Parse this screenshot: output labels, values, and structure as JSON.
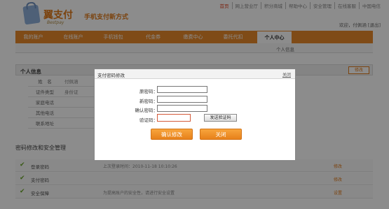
{
  "brand": {
    "logo_text": "翼支付",
    "logo_sub": "Bestpay",
    "slogan": "手机支付新方式"
  },
  "toplinks": [
    "首页",
    "网上营业厅",
    "积分商城",
    "帮助中心",
    "安全管理",
    "在线客服",
    "中国电信"
  ],
  "welcome": "欢迎，付佩涵 [退出]",
  "nav": [
    {
      "label": "我的账户"
    },
    {
      "label": "在线账户"
    },
    {
      "label": "手机钱包"
    },
    {
      "label": "代金券"
    },
    {
      "label": "缴费中心"
    },
    {
      "label": "委托代扣"
    },
    {
      "label": "个人中心",
      "active": true
    }
  ],
  "subnav": "个人信息",
  "info": {
    "title": "个人信息",
    "edit": "修改",
    "rows": [
      {
        "label": "姓　名",
        "value": "付佩涵"
      },
      {
        "label": "证件类型",
        "value": "身份证"
      },
      {
        "label": "家庭电话",
        "value": ""
      },
      {
        "label": "其他电话",
        "value": ""
      },
      {
        "label": "联系地址",
        "value": ""
      }
    ]
  },
  "security": {
    "title": "密码修改和安全管理",
    "rows": [
      {
        "name": "登录密码",
        "desc": "上次登录时间：2010-11-18 10:10:26",
        "action": "修改"
      },
      {
        "name": "支付密码",
        "desc": "",
        "action": "修改"
      },
      {
        "name": "安全保障",
        "desc": "为提高账户的安全性，请进行安全设置",
        "action": "设置"
      }
    ]
  },
  "modal": {
    "title": "支付密码修改",
    "close": "关闭",
    "fields": {
      "old": "原密码：",
      "new": "新密码：",
      "confirm": "确认密码：",
      "code": "验证码："
    },
    "send_code": "发送验证码",
    "confirm_btn": "确认修改",
    "cancel_btn": "关闭"
  },
  "colors": {
    "accent": "#e8892a",
    "overlay": "rgba(0,0,0,0.45)"
  }
}
